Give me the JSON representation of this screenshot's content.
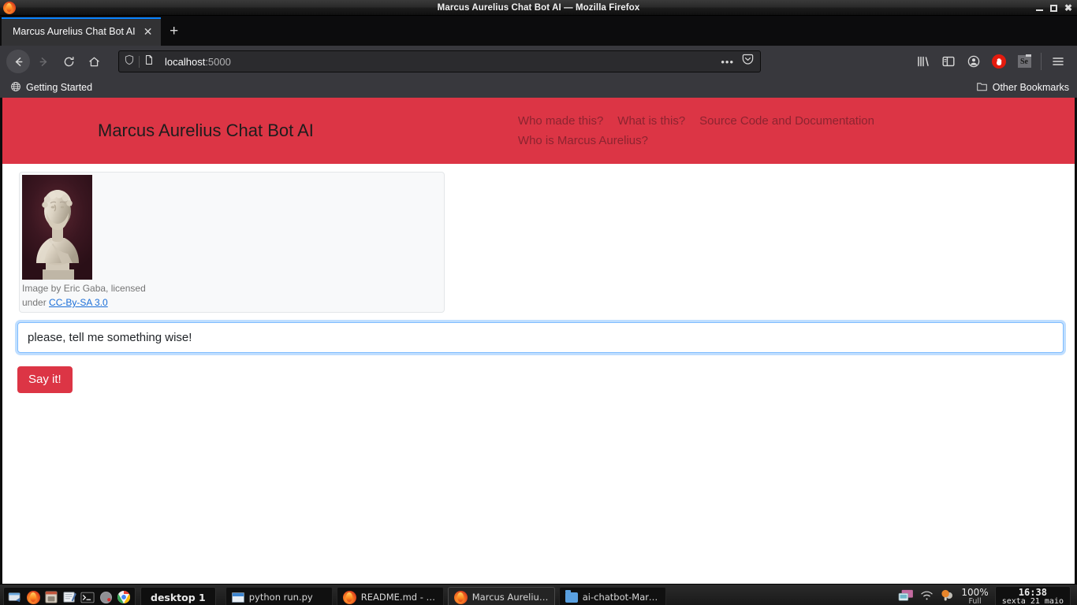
{
  "window": {
    "title": "Marcus Aurelius Chat Bot AI — Mozilla Firefox",
    "minimize_label": "—",
    "maximize_label": "□",
    "close_label": "✕"
  },
  "browser": {
    "tab": {
      "title": "Marcus Aurelius Chat Bot AI",
      "close_label": "✕"
    },
    "new_tab_label": "+",
    "nav": {
      "back": "back-arrow",
      "forward": "forward-arrow",
      "reload": "reload-arrow",
      "home": "home-house"
    },
    "url": {
      "host": "localhost",
      "port": ":5000",
      "shield_icon": "tracking-protection-shield",
      "page_icon": "page-document-icon",
      "page_actions_label": "•••",
      "pocket_icon": "pocket-icon"
    },
    "toolbar_icons": [
      {
        "name": "library-icon"
      },
      {
        "name": "sidebar-icon"
      },
      {
        "name": "account-icon"
      },
      {
        "name": "ublock-hand-icon"
      },
      {
        "name": "selenium-ide-icon",
        "label": "Se"
      },
      {
        "name": "app-menu-icon"
      }
    ],
    "bookmarks": {
      "getting_started": "Getting Started",
      "other_bookmarks": "Other Bookmarks"
    }
  },
  "page": {
    "brand": "Marcus Aurelius Chat Bot AI",
    "nav_links": [
      "Who made this?",
      "What is this?",
      "Source Code and Documentation",
      "Who is Marcus Aurelius?"
    ],
    "card": {
      "image_alt": "Bust of Marcus Aurelius",
      "caption_prefix": "Image by Eric Gaba, licensed under ",
      "caption_line1": "Image by Eric Gaba, licensed",
      "caption_line2_prefix": "under ",
      "license_link": "CC-By-SA 3.0"
    },
    "input": {
      "value": "please, tell me something wise!",
      "placeholder": ""
    },
    "submit_label": "Say it!",
    "colors": {
      "banner": "#dc3545",
      "button": "#dc3545",
      "link": "#1a6ed8",
      "nav_link": "#8c2430"
    }
  },
  "taskbar": {
    "launchers": [
      {
        "name": "window-switcher-icon"
      },
      {
        "name": "firefox-icon"
      },
      {
        "name": "file-manager-icon"
      },
      {
        "name": "text-editor-icon"
      },
      {
        "name": "terminal-icon"
      },
      {
        "name": "media-icon"
      },
      {
        "name": "chrome-icon"
      }
    ],
    "desktop_label": "desktop 1",
    "tasks": [
      {
        "label": "python run.py",
        "icon": "window-icon",
        "active": false
      },
      {
        "label": "README.md - Grip...",
        "icon": "firefox-icon",
        "active": false
      },
      {
        "label": "Marcus Aurelius C...",
        "icon": "firefox-icon",
        "active": true
      },
      {
        "label": "ai-chatbot-Marcu...",
        "icon": "folder-icon",
        "active": false
      }
    ],
    "tray": {
      "display_icon": "display-icon",
      "wifi_icon": "wifi-icon",
      "brightness_icon": "brightness-icon",
      "battery_percent": "100%",
      "battery_state": "Full",
      "time": "16:38",
      "date": "sexta 21 maio"
    }
  }
}
